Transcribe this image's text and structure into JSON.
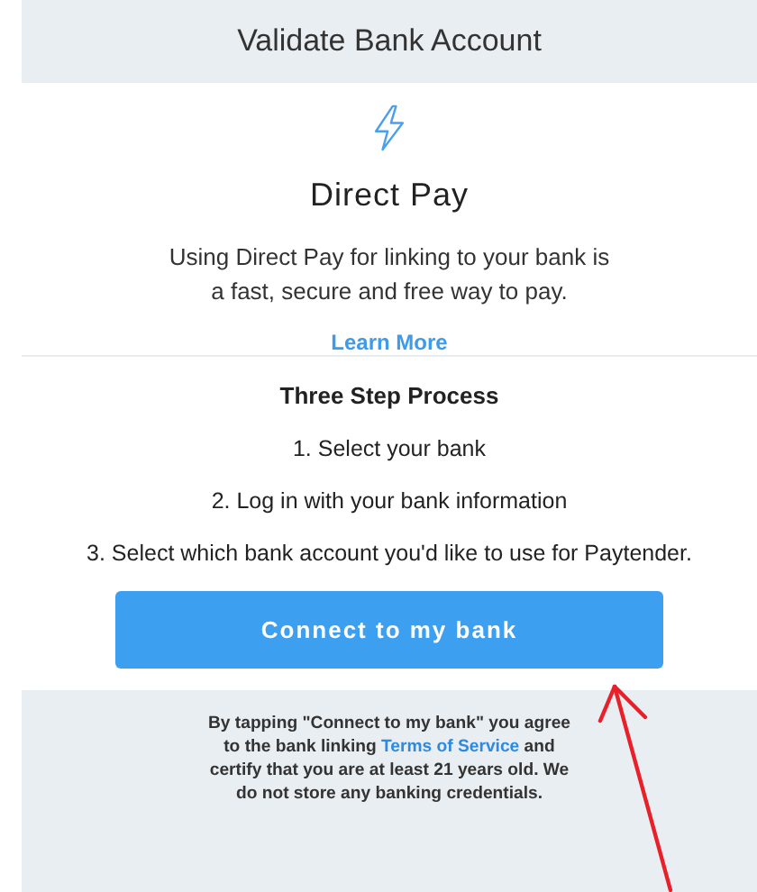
{
  "header": {
    "title": "Validate Bank Account"
  },
  "intro": {
    "title": "Direct Pay",
    "description": "Using Direct Pay for linking to your bank is a fast, secure and free way to pay.",
    "link": "Learn More"
  },
  "process": {
    "title": "Three Step Process",
    "steps": [
      "1. Select your bank",
      "2. Log in with your bank information",
      "3. Select which bank account you'd like to use for Paytender."
    ]
  },
  "button": "Connect to my bank",
  "disclaimer": {
    "before": "By tapping \"Connect to my bank\" you agree to the bank linking ",
    "link": "Terms of Service",
    "after": " and certify that you are at least 21 years old. We do not store any banking credentials."
  }
}
